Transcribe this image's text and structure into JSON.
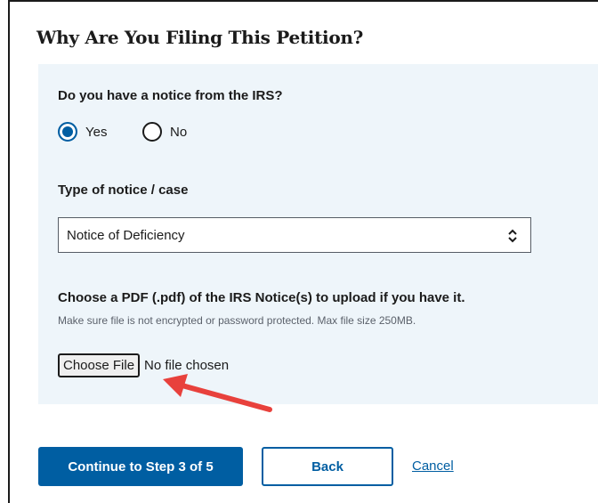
{
  "section_title": "Why Are You Filing This Petition?",
  "notice_question": {
    "label": "Do you have a notice from the IRS?",
    "options": [
      {
        "label": "Yes",
        "checked": true
      },
      {
        "label": "No",
        "checked": false
      }
    ]
  },
  "notice_type": {
    "label": "Type of notice / case",
    "selected": "Notice of Deficiency"
  },
  "upload": {
    "label": "Choose a PDF (.pdf) of the IRS Notice(s) to upload if you have it.",
    "hint": "Make sure file is not encrypted or password protected. Max file size 250MB.",
    "button_label": "Choose File",
    "status": "No file chosen"
  },
  "actions": {
    "continue_label": "Continue to Step 3 of 5",
    "back_label": "Back",
    "cancel_label": "Cancel"
  },
  "colors": {
    "primary": "#005ea2",
    "panel_bg": "#eef5fa",
    "annotation_arrow": "#e8413c"
  },
  "icons": {
    "select": "chevron-up-down-icon",
    "annotation": "red-arrow-annotation"
  }
}
